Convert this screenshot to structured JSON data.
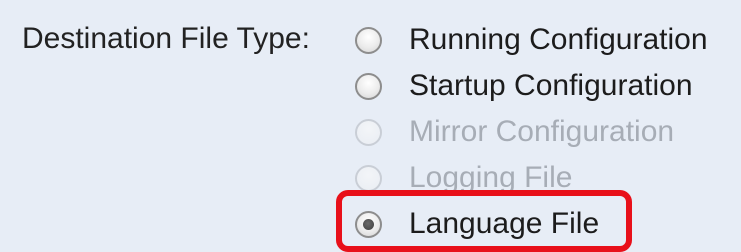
{
  "form": {
    "label": "Destination File Type:",
    "options": [
      {
        "label": "Running Configuration",
        "checked": false,
        "disabled": false
      },
      {
        "label": "Startup Configuration",
        "checked": false,
        "disabled": false
      },
      {
        "label": "Mirror Configuration",
        "checked": false,
        "disabled": true
      },
      {
        "label": "Logging File",
        "checked": false,
        "disabled": true
      },
      {
        "label": "Language File",
        "checked": true,
        "disabled": false
      }
    ]
  },
  "highlight_color": "#e8101a"
}
